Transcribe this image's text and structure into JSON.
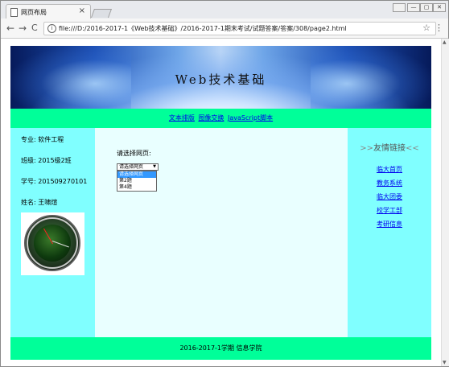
{
  "browser": {
    "tab_title": "网页布局",
    "tab_close": "×",
    "url": "file:///D:/2016-2017-1《Web技术基础》/2016-2017-1期末考试/试题答案/答案/308/page2.html",
    "back": "←",
    "forward": "→",
    "reload": "C",
    "info": "i",
    "star": "☆",
    "menu": "⋮",
    "win_user": "👤",
    "win_min": "—",
    "win_max": "▢",
    "win_close": "✕"
  },
  "header": {
    "title": "Web技术基础"
  },
  "nav": {
    "links": [
      "文本排版",
      "图像交换",
      "JavaScript脚本"
    ]
  },
  "sidebar": {
    "major": "专业:  软件工程",
    "class": "班级:  2015级2班",
    "student_id": "学号:  201509270101",
    "name": "姓名:  王啸煊"
  },
  "main": {
    "prompt": "请选择网页:",
    "select_value": "请选择网页",
    "select_arrow": "▼",
    "options": [
      "请选择网页",
      "第2题",
      "第4题"
    ]
  },
  "links_panel": {
    "title_left": ">>",
    "title": "友情链接",
    "title_right": "<<",
    "items": [
      "临大首页",
      "教务系统",
      "临大团委",
      "校学工部",
      "考研信息"
    ]
  },
  "footer": {
    "text": "2016-2017-1学期  信息学院"
  },
  "colors": {
    "nav_bg": "#00ff99",
    "side_bg": "#80ffff",
    "main_bg": "#e9ffff",
    "link": "#0000ee"
  }
}
